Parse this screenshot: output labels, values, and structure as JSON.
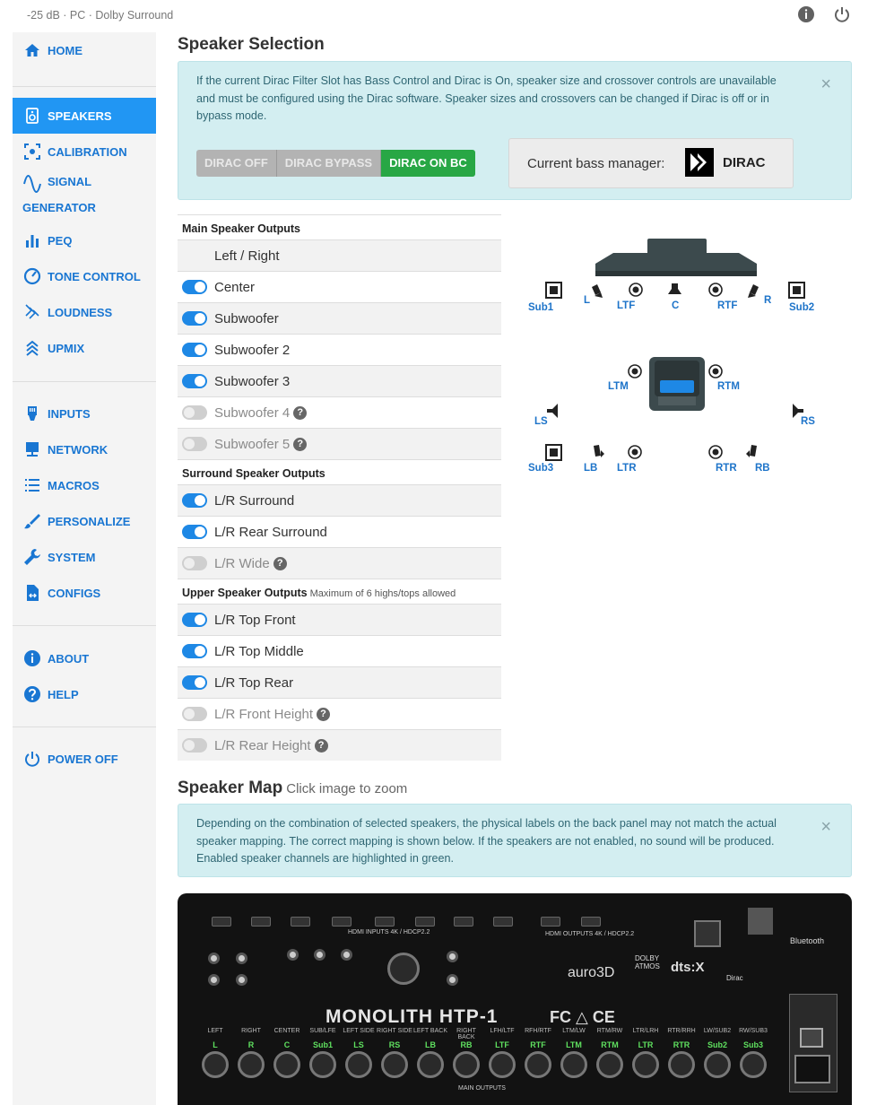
{
  "topbar": {
    "status": "-25 dB · PC · Dolby Surround"
  },
  "sidebar": {
    "items": [
      {
        "label": "HOME"
      },
      {
        "label": "SPEAKERS"
      },
      {
        "label": "CALIBRATION"
      },
      {
        "label": "SIGNAL",
        "label2": "GENERATOR"
      },
      {
        "label": "PEQ"
      },
      {
        "label": "TONE CONTROL"
      },
      {
        "label": "LOUDNESS"
      },
      {
        "label": "UPMIX"
      },
      {
        "label": "INPUTS"
      },
      {
        "label": "NETWORK"
      },
      {
        "label": "MACROS"
      },
      {
        "label": "PERSONALIZE"
      },
      {
        "label": "SYSTEM"
      },
      {
        "label": "CONFIGS"
      },
      {
        "label": "ABOUT"
      },
      {
        "label": "HELP"
      },
      {
        "label": "POWER OFF"
      }
    ]
  },
  "speaker_selection": {
    "title": "Speaker Selection",
    "alert": "If the current Dirac Filter Slot has Bass Control and Dirac is On, speaker size and crossover controls are unavailable and must be configured using the Dirac software. Speaker sizes and crossovers can be changed if Dirac is off or in bypass mode.",
    "dirac_off": "DIRAC OFF",
    "dirac_bypass": "DIRAC BYPASS",
    "dirac_on": "DIRAC ON BC",
    "bass_manager_label": "Current bass manager:",
    "bass_manager_value": "DIRAC",
    "close": "×"
  },
  "outputs": {
    "main_title": "Main Speaker Outputs",
    "main": [
      {
        "label": "Left / Right"
      },
      {
        "label": "Center"
      },
      {
        "label": "Subwoofer"
      },
      {
        "label": "Subwoofer 2"
      },
      {
        "label": "Subwoofer 3"
      },
      {
        "label": "Subwoofer 4"
      },
      {
        "label": "Subwoofer 5"
      }
    ],
    "surround_title": "Surround Speaker Outputs",
    "surround": [
      {
        "label": "L/R Surround"
      },
      {
        "label": "L/R Rear Surround"
      },
      {
        "label": "L/R Wide"
      }
    ],
    "upper_title": "Upper Speaker Outputs",
    "upper_note": "Maximum of 6 highs/tops allowed",
    "upper": [
      {
        "label": "L/R Top Front"
      },
      {
        "label": "L/R Top Middle"
      },
      {
        "label": "L/R Top Rear"
      },
      {
        "label": "L/R Front Height"
      },
      {
        "label": "L/R Rear Height"
      }
    ],
    "help_glyph": "?"
  },
  "layout_labels": {
    "sub1": "Sub1",
    "l": "L",
    "ltf": "LTF",
    "c": "C",
    "rtf": "RTF",
    "r": "R",
    "sub2": "Sub2",
    "ltm": "LTM",
    "rtm": "RTM",
    "ls": "LS",
    "rs": "RS",
    "sub3": "Sub3",
    "lb": "LB",
    "ltr": "LTR",
    "rtr": "RTR",
    "rb": "RB"
  },
  "speaker_map": {
    "title": "Speaker Map",
    "subtitle": "Click image to zoom",
    "alert": "Depending on the combination of selected speakers, the physical labels on the back panel may not match the actual speaker mapping. The correct mapping is shown below. If the speakers are not enabled, no sound will be produced. Enabled speaker channels are highlighted in green.",
    "brand": "MONOLITH HTP-1",
    "panel_labels": [
      "LEFT",
      "RIGHT",
      "CENTER",
      "SUB/LFE",
      "LEFT SIDE",
      "RIGHT SIDE",
      "LEFT BACK",
      "RIGHT BACK",
      "LFH/LTF",
      "RFH/RTF",
      "LTM/LW",
      "RTM/RW",
      "LTR/LRH",
      "RTR/RRH",
      "LW/SUB2",
      "RW/SUB3"
    ],
    "green_labels": [
      "L",
      "R",
      "C",
      "Sub1",
      "LS",
      "RS",
      "LB",
      "RB",
      "LTF",
      "RTF",
      "LTM",
      "RTM",
      "LTR",
      "RTR",
      "Sub2",
      "Sub3"
    ],
    "main_outputs": "MAIN OUTPUTS",
    "hdmi_inputs": "HDMI INPUTS 4K / HDCP2.2",
    "hdmi_outputs": "HDMI OUTPUTS 4K / HDCP2.2",
    "bluetooth": "Bluetooth",
    "auro": "auro3D",
    "dolby": "DOLBY ATMOS",
    "dts": "dts:X",
    "dirac": "Dirac",
    "fc": "FC △ CE"
  }
}
